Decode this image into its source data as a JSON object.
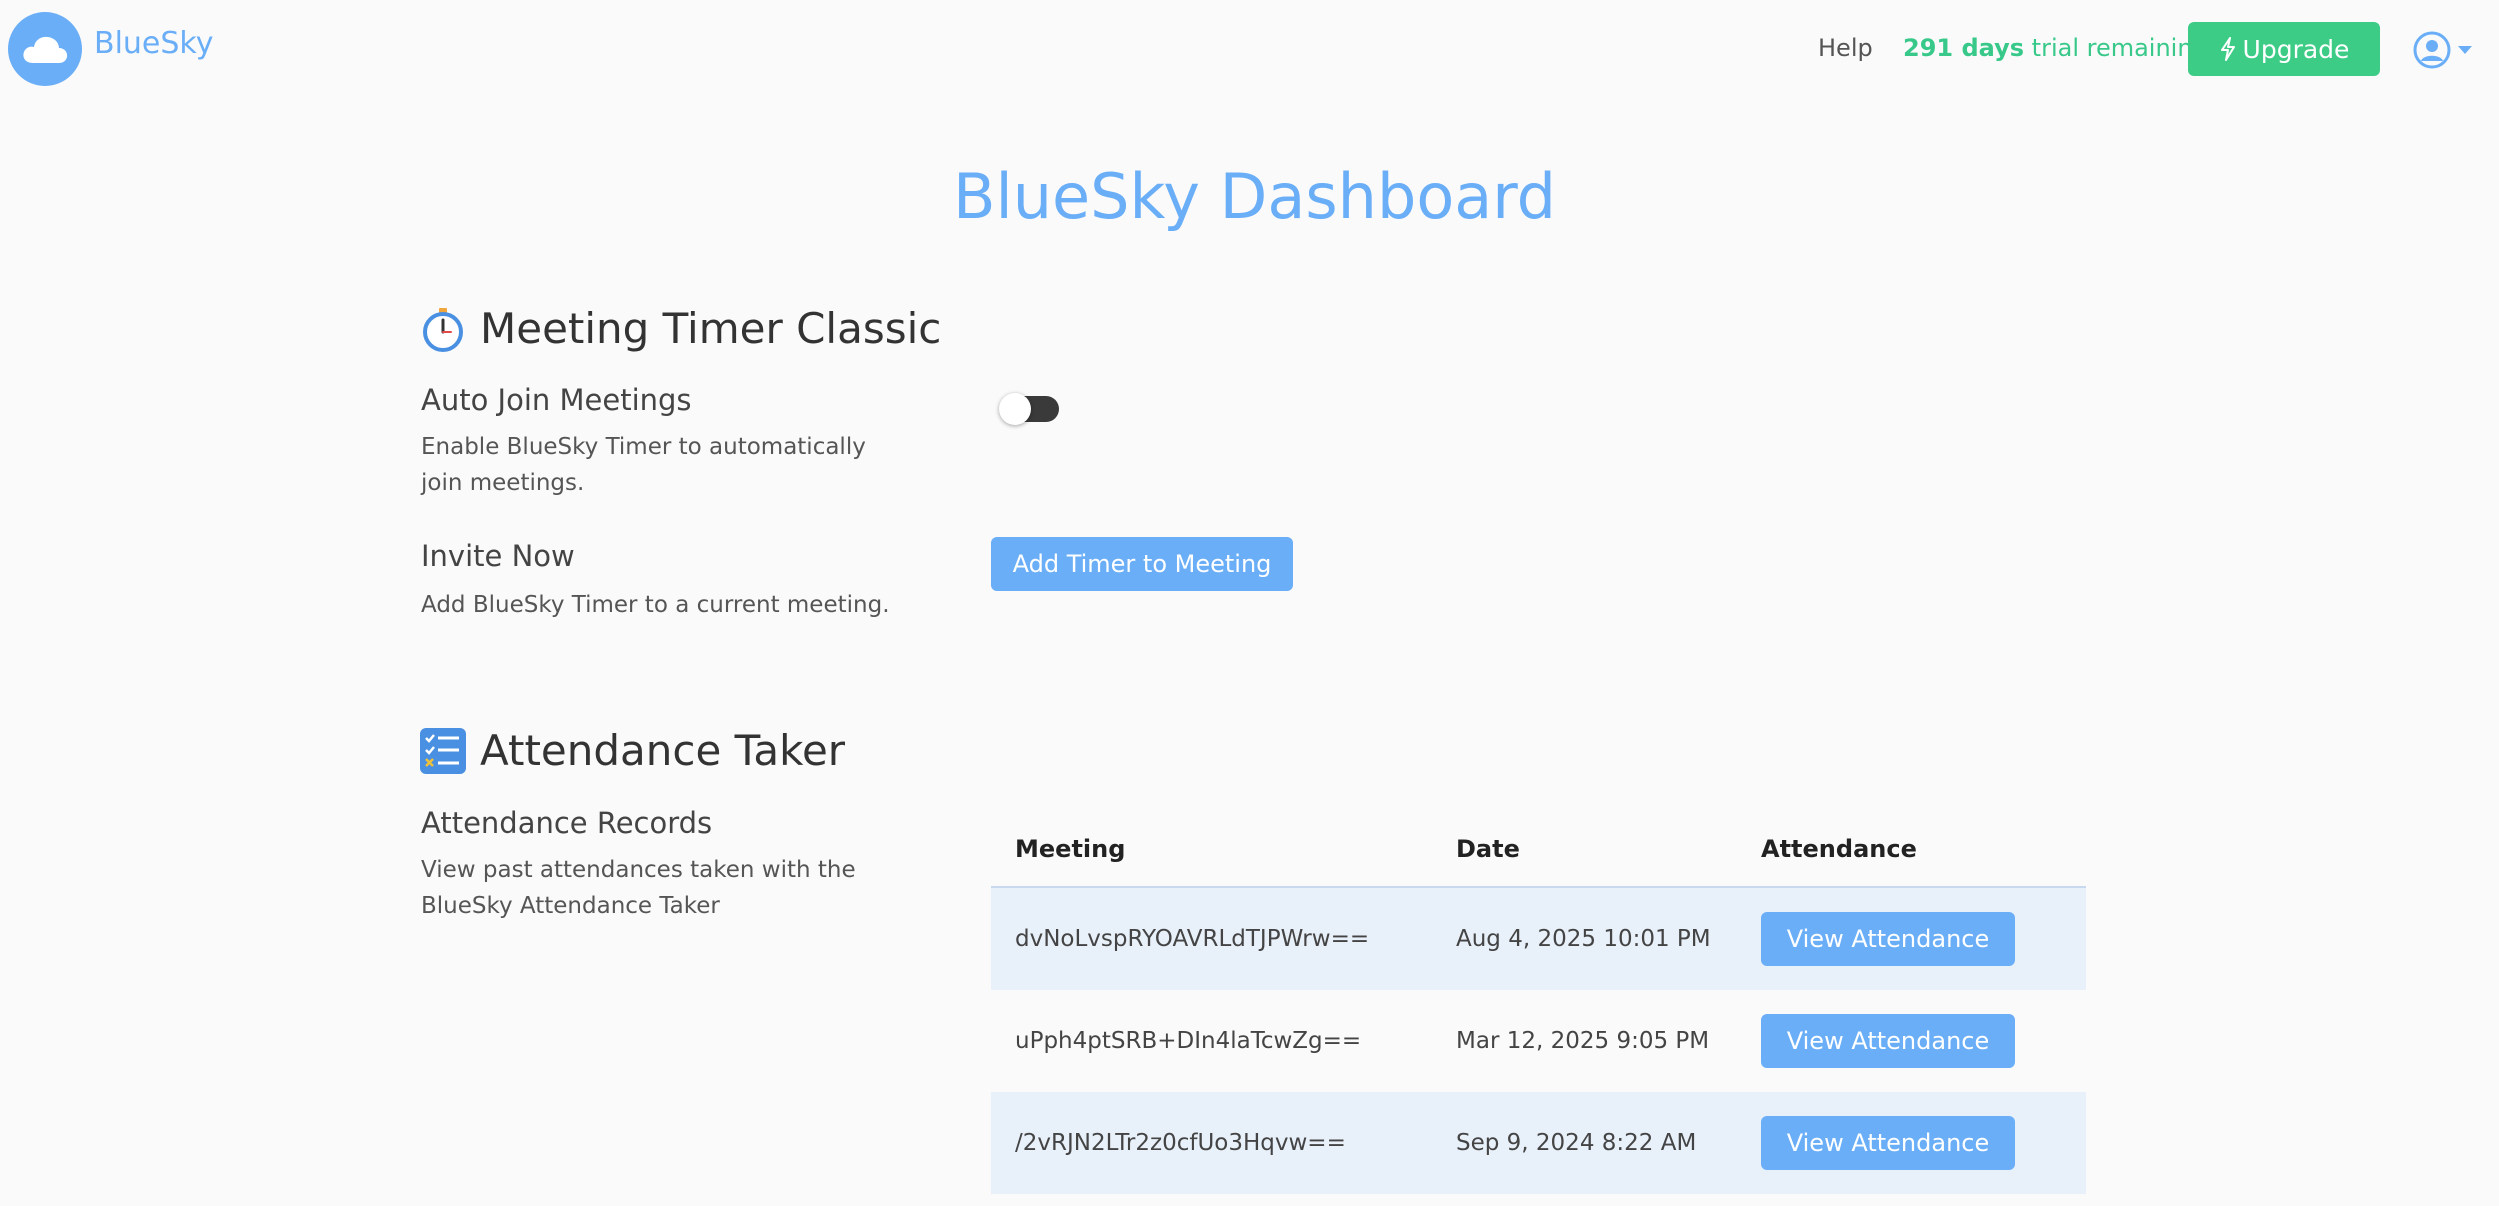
{
  "header": {
    "brand": "BlueSky",
    "help": "Help",
    "trial_days": "291 days",
    "trial_suffix": " trial remaining",
    "upgrade_label": "Upgrade"
  },
  "page_title": "BlueSky Dashboard",
  "meeting_timer": {
    "title": "Meeting Timer Classic",
    "auto_join": {
      "title": "Auto Join Meetings",
      "desc": "Enable BlueSky Timer to automatically join meetings.",
      "enabled": false
    },
    "invite": {
      "title": "Invite Now",
      "desc": "Add BlueSky Timer to a current meeting.",
      "button": "Add Timer to Meeting"
    }
  },
  "attendance": {
    "title": "Attendance Taker",
    "records_title": "Attendance Records",
    "records_desc": "View past attendances taken with the BlueSky Attendance Taker",
    "columns": [
      "Meeting",
      "Date",
      "Attendance"
    ],
    "rows": [
      {
        "meeting": "dvNoLvspRYOAVRLdTJPWrw==",
        "date": "Aug 4, 2025 10:01 PM",
        "action": "View Attendance"
      },
      {
        "meeting": "uPph4ptSRB+DIn4laTcwZg==",
        "date": "Mar 12, 2025 9:05 PM",
        "action": "View Attendance"
      },
      {
        "meeting": "/2vRJN2LTr2z0cfUo3Hqvw==",
        "date": "Sep 9, 2024 8:22 AM",
        "action": "View Attendance"
      }
    ]
  },
  "colors": {
    "accent": "#6aaef7",
    "upgrade": "#3dcc86",
    "trial_text": "#38c98a",
    "row_shade": "#e8f0fa"
  },
  "icons": {
    "logo": "cloud-icon",
    "upgrade": "lightning-icon",
    "account": "user-circle-icon",
    "timer": "stopwatch-icon",
    "attendance": "checklist-icon"
  }
}
